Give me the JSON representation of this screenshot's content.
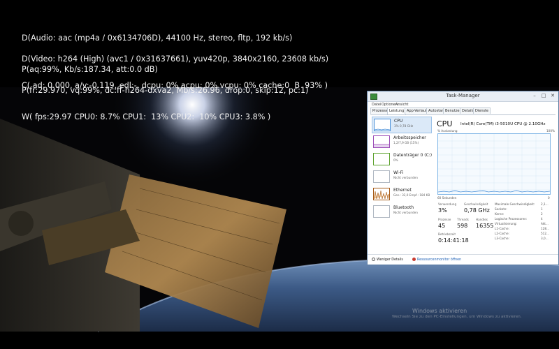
{
  "osd": {
    "audio_line1": "D(Audio: aac (mp4a / 0x6134706D), 44100 Hz, stereo, fltp, 192 kb/s)",
    "audio_line2": "P(aq:99%, Kb/s:187.34, att:0.0 dB)",
    "video_line1": "D(Video: h264 (High) (avc1 / 0x31637661), yuv420p, 3840x2160, 23608 kb/s)",
    "video_line2": "P(fr:29.970, vq:99%, dc:ff-h264-dxva2, Mb/s:26.96, drop:0, skip:12, pc:1)",
    "control_line": "C( ad: 0.000, a/v:-0.119, edl:-, dcpu: 0% acpu: 0% vcpu: 0% cache:0  B  93% )",
    "cpu_line": "W( fps:29.97 CPU0: 8.7% CPU1:  13% CPU2:  10% CPU3: 3.8% )"
  },
  "taskmanager": {
    "title": "Task-Manager",
    "menu": [
      "Datei",
      "Optionen",
      "Ansicht"
    ],
    "tabs": [
      "Prozesse",
      "Leistung",
      "App-Verlauf",
      "Autostart",
      "Benutzer",
      "Details",
      "Dienste"
    ],
    "active_tab": "Leistung",
    "perf_items": [
      {
        "name": "CPU",
        "sub": "3% 0,78 GHz",
        "icon": "cpu-graph-icon"
      },
      {
        "name": "Arbeitsspeicher",
        "sub": "1,2/7,9 GB (15%)",
        "icon": "memory-graph-icon"
      },
      {
        "name": "Datenträger 0 (C:)",
        "sub": "0%",
        "icon": "disk-graph-icon"
      },
      {
        "name": "Wi-Fi",
        "sub": "Nicht verbunden",
        "icon": "wifi-graph-icon"
      },
      {
        "name": "Ethernet",
        "sub": "Ges.: 32,0 Empf.: 184 KB",
        "icon": "ethernet-graph-icon"
      },
      {
        "name": "Bluetooth",
        "sub": "Nicht verbunden",
        "icon": "bluetooth-graph-icon"
      }
    ],
    "cpu_heading": "CPU",
    "cpu_model": "Intel(R) Core(TM) i3-5010U CPU @ 2.10GHz",
    "chart_top_left": "% Auslastung",
    "chart_top_right": "100%",
    "chart_bottom_left": "60 Sekunden",
    "chart_bottom_right": "0",
    "stats": {
      "usage_label": "Verwendung",
      "usage_value": "3%",
      "speed_label": "Geschwindigkeit",
      "speed_value": "0,78 GHz",
      "processes_label": "Prozesse",
      "processes_value": "45",
      "threads_label": "Threads",
      "threads_value": "598",
      "handles_label": "Handles",
      "handles_value": "16355",
      "uptime_label": "Betriebszeit",
      "uptime_value": "0:14:41:18"
    },
    "specs": [
      {
        "label": "Maximale Geschwindigkeit:",
        "value": "2,1..."
      },
      {
        "label": "Sockets:",
        "value": "1"
      },
      {
        "label": "Kerne:",
        "value": "2"
      },
      {
        "label": "Logische Prozessoren:",
        "value": "4"
      },
      {
        "label": "Virtualisierung:",
        "value": "Akt..."
      },
      {
        "label": "L1-Cache:",
        "value": "128..."
      },
      {
        "label": "L2-Cache:",
        "value": "512..."
      },
      {
        "label": "L3-Cache:",
        "value": "3,0..."
      }
    ],
    "footer_fewer": "Weniger Details",
    "footer_resmon": "Ressourcenmonitor öffnen"
  },
  "watermark": {
    "line1": "Windows aktivieren",
    "line2": "Wechseln Sie zu den PC-Einstellungen, um Windows zu aktivieren."
  },
  "colors": {
    "chart_line": "#4a90d9",
    "chart_fill": "#f5fafe",
    "selected_item": "#dbe9f8",
    "link": "#1b5fb5"
  }
}
